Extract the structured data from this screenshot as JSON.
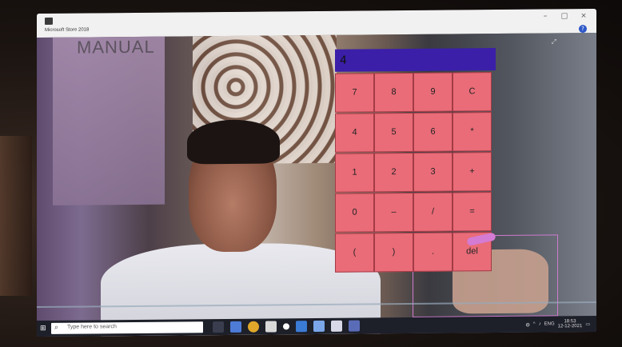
{
  "window": {
    "title": "Microsoft Store 2018",
    "controls": [
      "–",
      "□",
      "×"
    ]
  },
  "video_overlay": {
    "watermark_text": "MANUAL"
  },
  "calculator": {
    "display": "4",
    "rows": [
      [
        "7",
        "8",
        "9",
        "C"
      ],
      [
        "4",
        "5",
        "6",
        "*"
      ],
      [
        "1",
        "2",
        "3",
        "+"
      ],
      [
        "0",
        "–",
        "/",
        "="
      ],
      [
        "(",
        ")",
        ".",
        "del"
      ]
    ]
  },
  "taskbar": {
    "search_placeholder": "Type here to search",
    "tray_lang": "ENG",
    "time": "18:53",
    "date": "12-12-2021"
  },
  "colors": {
    "display_bg": "#3b1fa8",
    "button_bg": "#e96c78",
    "hand_box": "#d07ad0"
  }
}
